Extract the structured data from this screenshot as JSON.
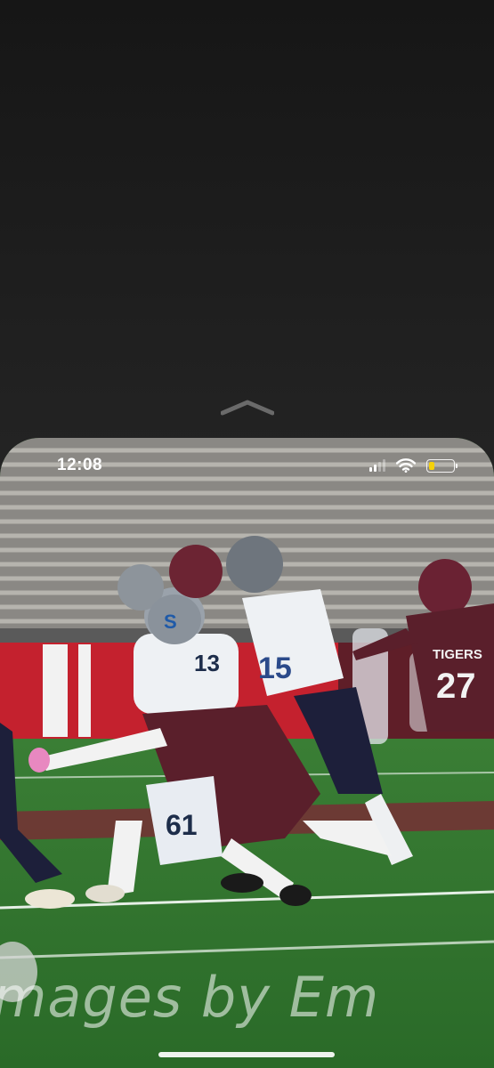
{
  "status_bar": {
    "time": "12:08",
    "signal_bars_active": 2,
    "signal_bars_total": 4,
    "battery_level": 0.25,
    "battery_color": "#f5d10a"
  },
  "pull_indicator": {
    "icon": "chevron-up-icon"
  },
  "photo": {
    "jersey_numbers": [
      "13",
      "15",
      "27",
      "61"
    ],
    "jersey_team_text": "TIGERS",
    "helmet_letter": "S"
  },
  "watermark": {
    "text": "mages by Em"
  },
  "colors": {
    "maroon": "#5a1f2b",
    "field_green": "#2e7a2c",
    "jersey_white": "#e8eef2",
    "accent_blue": "#7ab3d6"
  }
}
